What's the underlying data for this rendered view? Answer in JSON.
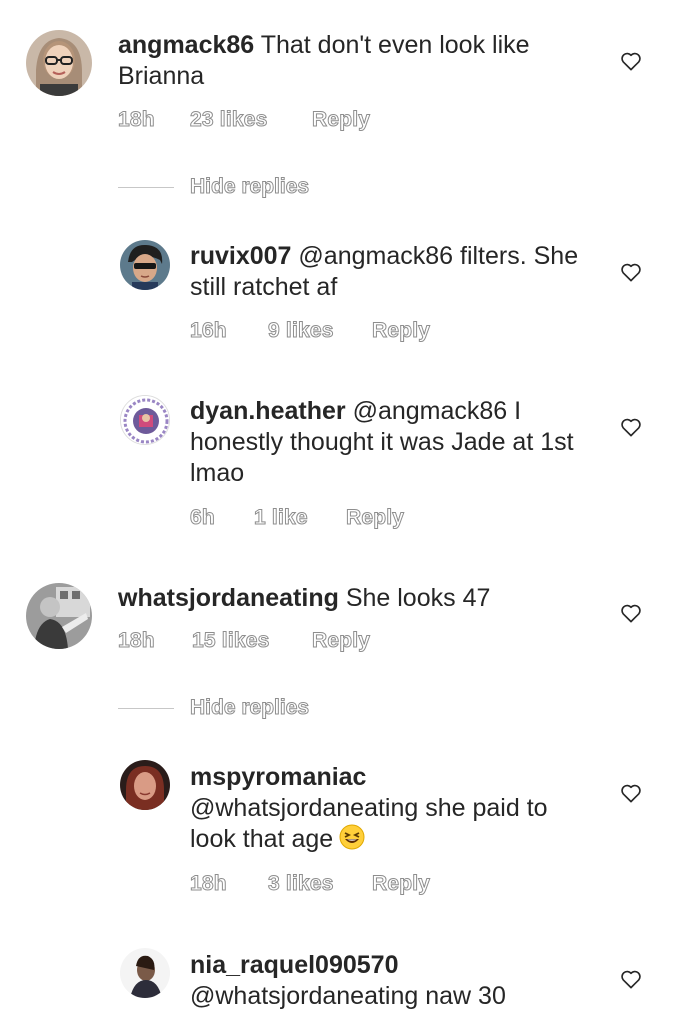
{
  "comments": [
    {
      "username": "angmack86",
      "text": "That don't even look like Brianna",
      "time": "18h",
      "likes": "23 likes",
      "reply": "Reply",
      "hide_replies": "Hide replies",
      "replies": [
        {
          "username": "ruvix007",
          "text": "@angmack86 filters. She still ratchet af",
          "time": "16h",
          "likes": "9 likes",
          "reply": "Reply"
        },
        {
          "username": "dyan.heather",
          "text": "@angmack86 I honestly thought it was Jade at 1st lmao",
          "time": "6h",
          "likes": "1 like",
          "reply": "Reply"
        }
      ]
    },
    {
      "username": "whatsjordaneating",
      "text": "She looks 47",
      "time": "18h",
      "likes": "15 likes",
      "reply": "Reply",
      "hide_replies": "Hide replies",
      "replies": [
        {
          "username": "mspyromaniac",
          "text": "@whatsjordaneating she paid to look that age",
          "time": "18h",
          "likes": "3 likes",
          "reply": "Reply"
        },
        {
          "username": "nia_raquel090570",
          "text": "@whatsjordaneating naw 30"
        }
      ]
    }
  ],
  "icons": {
    "like": "heart-outline-icon",
    "emoji": "grinning-squinting-face-emoji"
  }
}
